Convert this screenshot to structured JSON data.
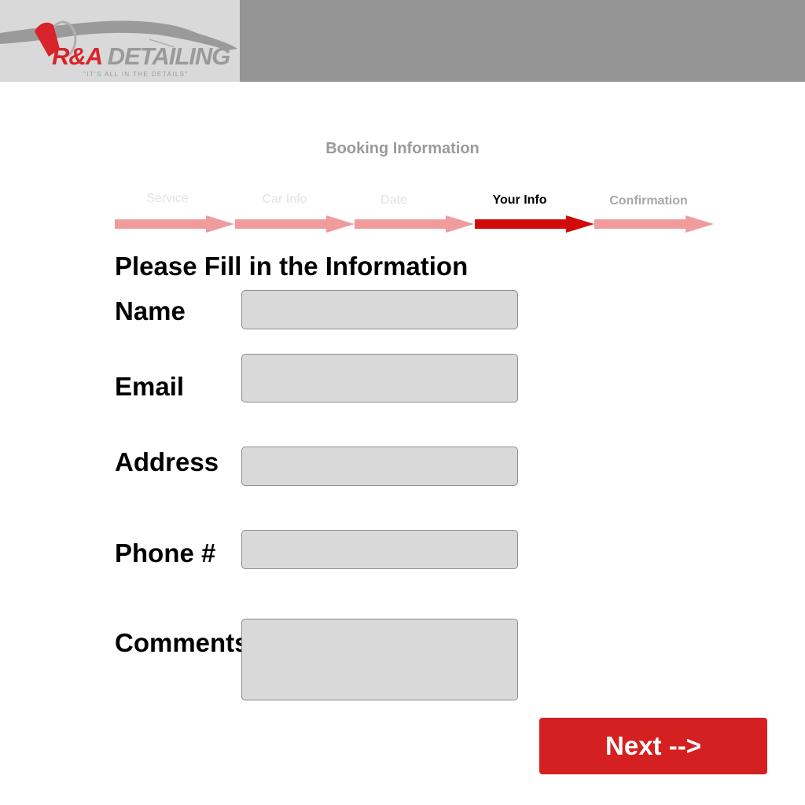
{
  "header": {
    "logo": {
      "brand_ra": "R&A ",
      "brand_rest": "DETAILING",
      "tagline": "\"IT'S ALL IN THE DETAILS\""
    }
  },
  "booking": {
    "title": "Booking Information",
    "steps": [
      {
        "label": "Service",
        "state": "completed"
      },
      {
        "label": "Car Info",
        "state": "completed"
      },
      {
        "label": "Date",
        "state": "completed"
      },
      {
        "label": "Your Info",
        "state": "current"
      },
      {
        "label": "Confirmation",
        "state": "upcoming"
      }
    ],
    "colors": {
      "active": "#d10a0a",
      "inactive": "#f09c9c",
      "button": "#d42021",
      "brand_red": "#d9232a"
    }
  },
  "form": {
    "heading": "Please Fill in the Information",
    "fields": {
      "name": {
        "label": "Name",
        "value": ""
      },
      "email": {
        "label": "Email",
        "value": ""
      },
      "address": {
        "label": "Address",
        "value": ""
      },
      "phone": {
        "label": "Phone #",
        "value": ""
      },
      "comments": {
        "label": "Comments",
        "value": ""
      }
    },
    "next_label": "Next -->"
  }
}
